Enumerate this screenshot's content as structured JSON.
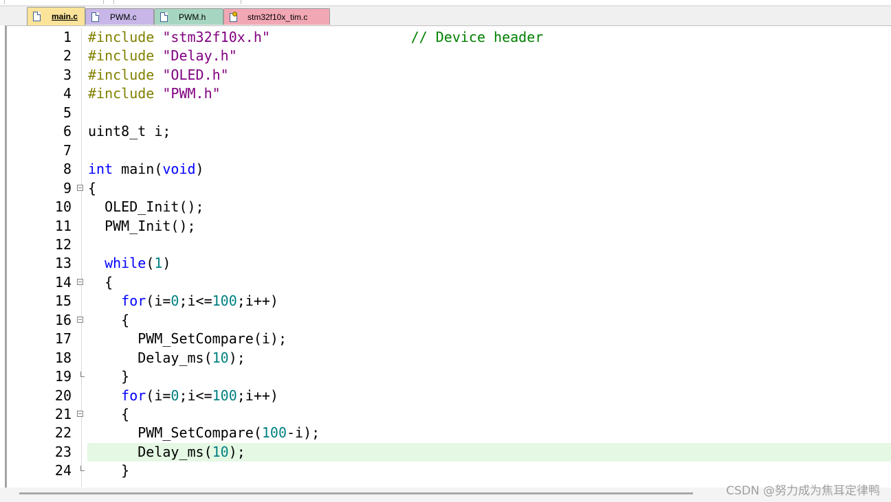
{
  "tabs": [
    {
      "label": "main.c",
      "active": true,
      "color": "#fbe39a",
      "icon": "c-file-icon"
    },
    {
      "label": "PWM.c",
      "active": false,
      "color": "#c8b6e8",
      "icon": "c-file-icon"
    },
    {
      "label": "PWM.h",
      "active": false,
      "color": "#a6d6c2",
      "icon": "header-file-icon"
    },
    {
      "label": "stm32f10x_tim.c",
      "active": false,
      "color": "#f2a8b4",
      "icon": "read-only-file-icon"
    }
  ],
  "editor": {
    "current_line": 23,
    "lines": [
      {
        "n": "1",
        "fold": "",
        "segs": [
          [
            "pp",
            "#include "
          ],
          [
            "str",
            "\"stm32f10x.h\""
          ],
          [
            "",
            "                 "
          ],
          [
            "cmt",
            "// Device header"
          ]
        ]
      },
      {
        "n": "2",
        "fold": "",
        "segs": [
          [
            "pp",
            "#include "
          ],
          [
            "str",
            "\"Delay.h\""
          ]
        ]
      },
      {
        "n": "3",
        "fold": "",
        "segs": [
          [
            "pp",
            "#include "
          ],
          [
            "str",
            "\"OLED.h\""
          ]
        ]
      },
      {
        "n": "4",
        "fold": "",
        "segs": [
          [
            "pp",
            "#include "
          ],
          [
            "str",
            "\"PWM.h\""
          ]
        ]
      },
      {
        "n": "5",
        "fold": "",
        "segs": []
      },
      {
        "n": "6",
        "fold": "",
        "segs": [
          [
            "",
            "uint8_t i;"
          ]
        ]
      },
      {
        "n": "7",
        "fold": "",
        "segs": []
      },
      {
        "n": "8",
        "fold": "",
        "segs": [
          [
            "kw",
            "int"
          ],
          [
            "",
            " main("
          ],
          [
            "kw",
            "void"
          ],
          [
            "",
            ")"
          ]
        ]
      },
      {
        "n": "9",
        "fold": "open",
        "segs": [
          [
            "",
            "{"
          ]
        ]
      },
      {
        "n": "10",
        "fold": "",
        "segs": [
          [
            "",
            "  OLED_Init();"
          ]
        ]
      },
      {
        "n": "11",
        "fold": "",
        "segs": [
          [
            "",
            "  PWM_Init();"
          ]
        ]
      },
      {
        "n": "12",
        "fold": "",
        "segs": []
      },
      {
        "n": "13",
        "fold": "",
        "segs": [
          [
            "",
            "  "
          ],
          [
            "kw",
            "while"
          ],
          [
            "",
            "("
          ],
          [
            "numl",
            "1"
          ],
          [
            "",
            ")"
          ]
        ]
      },
      {
        "n": "14",
        "fold": "open",
        "segs": [
          [
            "",
            "  {"
          ]
        ]
      },
      {
        "n": "15",
        "fold": "",
        "segs": [
          [
            "",
            "    "
          ],
          [
            "kw",
            "for"
          ],
          [
            "",
            "(i="
          ],
          [
            "numl",
            "0"
          ],
          [
            "",
            ";i<="
          ],
          [
            "numl",
            "100"
          ],
          [
            "",
            ";i++)"
          ]
        ]
      },
      {
        "n": "16",
        "fold": "open",
        "segs": [
          [
            "",
            "    {"
          ]
        ]
      },
      {
        "n": "17",
        "fold": "",
        "segs": [
          [
            "",
            "      PWM_SetCompare(i);"
          ]
        ]
      },
      {
        "n": "18",
        "fold": "",
        "segs": [
          [
            "",
            "      Delay_ms("
          ],
          [
            "numl",
            "10"
          ],
          [
            "",
            ");"
          ]
        ]
      },
      {
        "n": "19",
        "fold": "end",
        "segs": [
          [
            "",
            "    }"
          ]
        ]
      },
      {
        "n": "20",
        "fold": "",
        "segs": [
          [
            "",
            "    "
          ],
          [
            "kw",
            "for"
          ],
          [
            "",
            "(i="
          ],
          [
            "numl",
            "0"
          ],
          [
            "",
            ";i<="
          ],
          [
            "numl",
            "100"
          ],
          [
            "",
            ";i++)"
          ]
        ]
      },
      {
        "n": "21",
        "fold": "open",
        "segs": [
          [
            "",
            "    {"
          ]
        ]
      },
      {
        "n": "22",
        "fold": "",
        "segs": [
          [
            "",
            "      PWM_SetCompare("
          ],
          [
            "numl",
            "100"
          ],
          [
            "",
            "-i);"
          ]
        ]
      },
      {
        "n": "23",
        "fold": "",
        "segs": [
          [
            "",
            "      Delay_ms("
          ],
          [
            "numl",
            "10"
          ],
          [
            "",
            ");"
          ]
        ]
      },
      {
        "n": "24",
        "fold": "end",
        "segs": [
          [
            "",
            "    }"
          ]
        ]
      }
    ]
  },
  "watermark": "CSDN @努力成为焦耳定律鸭"
}
